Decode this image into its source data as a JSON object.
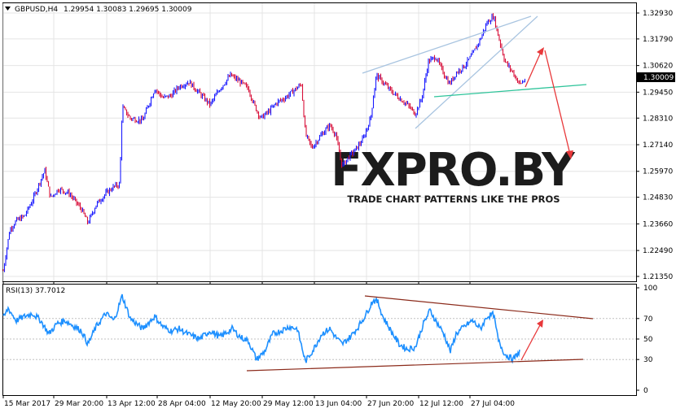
{
  "main_panel": {
    "symbol_label": "GBPUSD,H4",
    "ohlc_label": "1.29954 1.30083 1.29695 1.30009",
    "current_price_label": "1.30009",
    "price_ticks": [
      "1.32930",
      "1.31790",
      "1.30620",
      "1.29450",
      "1.28310",
      "1.27140",
      "1.25970",
      "1.24830",
      "1.23660",
      "1.22490",
      "1.21350"
    ],
    "ylim": [
      1.2135,
      1.3293
    ]
  },
  "rsi_panel": {
    "label": "RSI(13) 37.7012",
    "ticks": [
      "100",
      "70",
      "50",
      "30",
      "0"
    ],
    "ylim": [
      0,
      100
    ]
  },
  "time_axis": {
    "labels": [
      "15 Mar 2017",
      "29 Mar 20:00",
      "13 Apr 12:00",
      "28 Apr 04:00",
      "12 May 20:00",
      "29 May 12:00",
      "13 Jun 04:00",
      "27 Jun 20:00",
      "12 Jul 12:00",
      "27 Jul 04:00"
    ]
  },
  "watermark": {
    "logo_text": "FXPRO.BY",
    "tagline": "TRADE CHART PATTERNS LIKE THE PROS"
  },
  "colors": {
    "bull_candle": "#1a1aff",
    "bear_candle": "#d8103a",
    "rsi_line": "#1e90ff",
    "channel_line": "#a8c4e0",
    "support_line": "#2ec49a",
    "rsi_trend_line": "#8b2a1a",
    "arrow": "#e8383a",
    "grid": "#e4e4e4",
    "watermark": "#1c1c1c"
  },
  "chart_data": [
    {
      "type": "line",
      "title": "GBPUSD,H4",
      "x": [
        "15 Mar 2017",
        "29 Mar 20:00",
        "13 Apr 12:00",
        "28 Apr 04:00",
        "12 May 20:00",
        "29 May 12:00",
        "13 Jun 04:00",
        "27 Jun 20:00",
        "12 Jul 12:00",
        "27 Jul 04:00"
      ],
      "series": [
        {
          "name": "GBPUSD,H4",
          "values": [
            1.22,
            1.244,
            1.284,
            1.294,
            1.296,
            1.287,
            1.272,
            1.301,
            1.294,
            1.313
          ]
        }
      ],
      "ylim": [
        1.2135,
        1.3293
      ],
      "last": {
        "open": 1.29954,
        "high": 1.30083,
        "low": 1.29695,
        "close": 1.30009
      },
      "grid": true
    },
    {
      "type": "line",
      "title": "RSI(13) 37.7012",
      "x": [
        "15 Mar 2017",
        "29 Mar 20:00",
        "13 Apr 12:00",
        "28 Apr 04:00",
        "12 May 20:00",
        "29 May 12:00",
        "13 Jun 04:00",
        "27 Jun 20:00",
        "12 Jul 12:00",
        "27 Jul 04:00"
      ],
      "series": [
        {
          "name": "RSI(13)",
          "values": [
            70,
            55,
            62,
            68,
            55,
            50,
            48,
            62,
            54,
            37.7012
          ]
        }
      ],
      "ylim": [
        0,
        100
      ],
      "levels": [
        70,
        50,
        30
      ]
    }
  ]
}
